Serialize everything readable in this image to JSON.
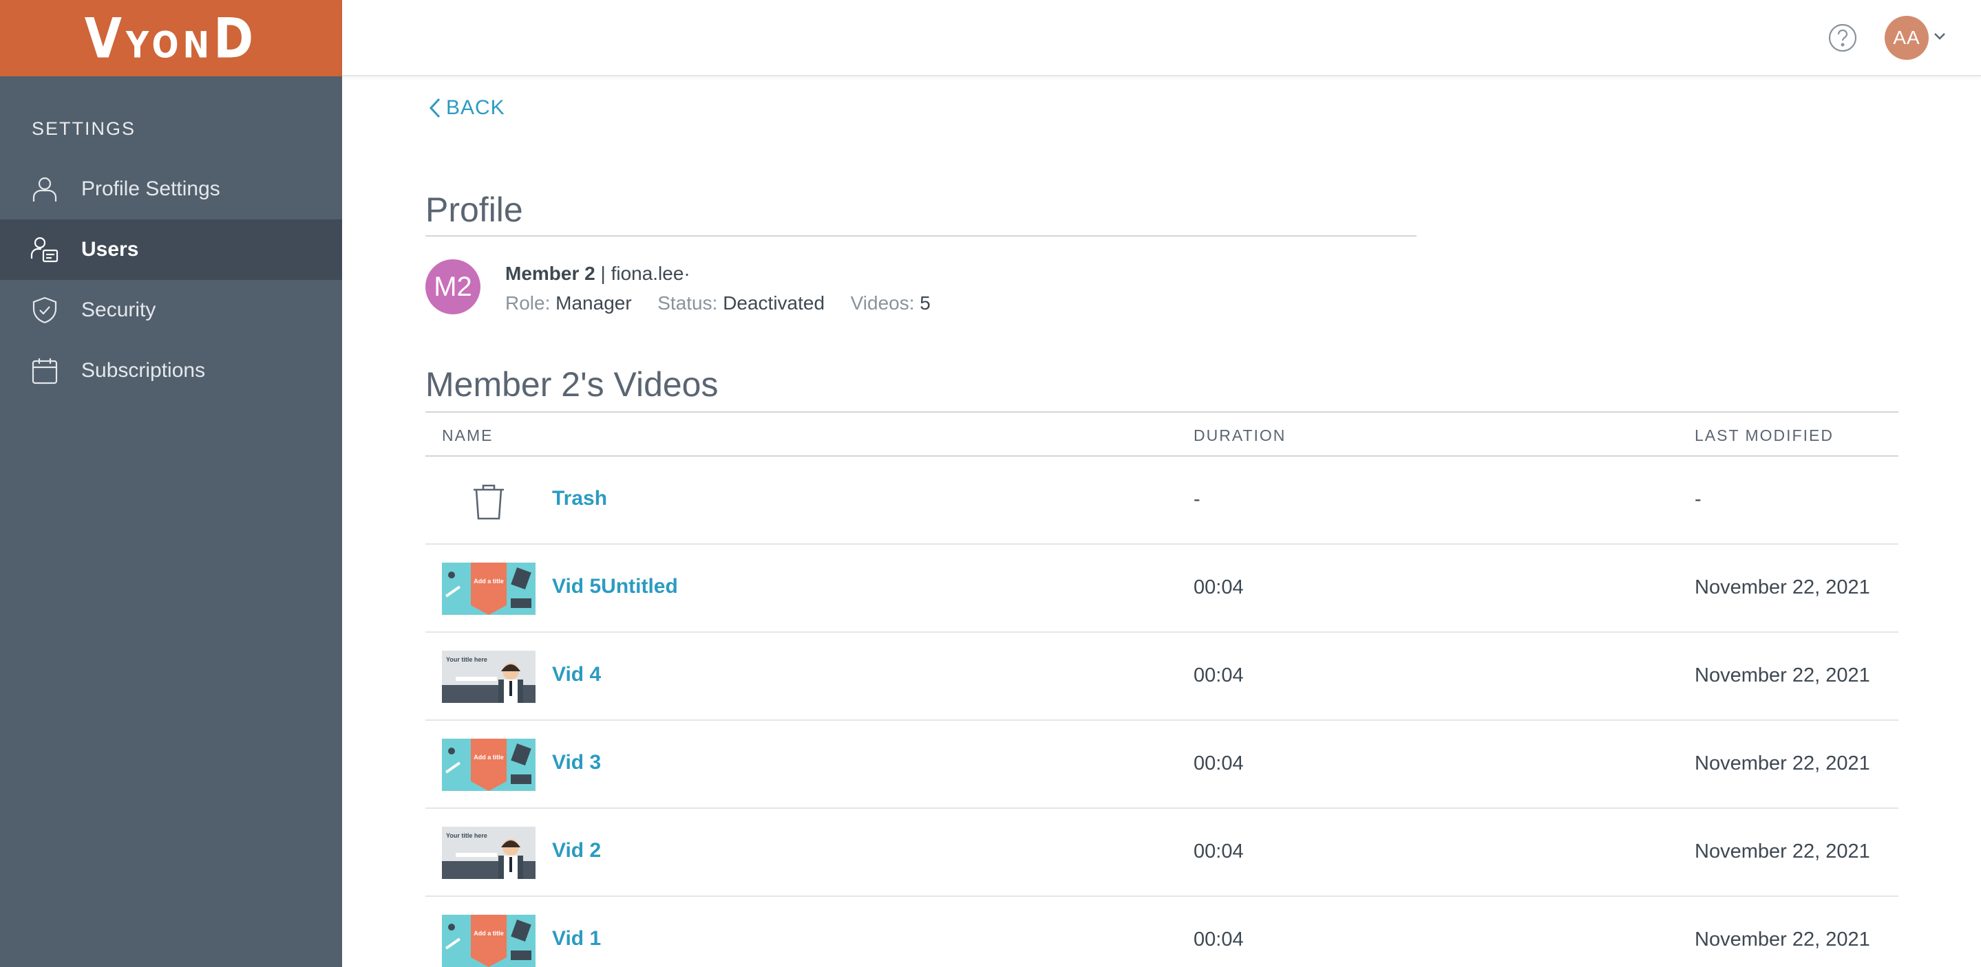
{
  "brand": {
    "logo_text": "VyonD",
    "color": "#cf6538"
  },
  "sidebar": {
    "heading": "SETTINGS",
    "items": [
      {
        "label": "Profile Settings",
        "icon": "person-icon",
        "active": false
      },
      {
        "label": "Users",
        "icon": "users-icon",
        "active": true
      },
      {
        "label": "Security",
        "icon": "shield-icon",
        "active": false
      },
      {
        "label": "Subscriptions",
        "icon": "calendar-icon",
        "active": false
      }
    ]
  },
  "topbar": {
    "help_icon": "help-icon",
    "avatar_initials": "AA"
  },
  "back": {
    "label": "BACK"
  },
  "profile": {
    "title": "Profile",
    "avatar_initials": "M2",
    "avatar_color": "#c86fb9",
    "name": "Member 2",
    "separator": "|",
    "email": "fiona.lee·",
    "role_label": "Role:",
    "role": "Manager",
    "status_label": "Status:",
    "status": "Deactivated",
    "videos_label": "Videos:",
    "videos": "5"
  },
  "videos": {
    "title": "Member 2's Videos",
    "columns": {
      "name": "NAME",
      "duration": "DURATION",
      "modified": "LAST MODIFIED"
    },
    "rows": [
      {
        "name": "Trash",
        "duration": "-",
        "modified": "-",
        "thumb": "trash"
      },
      {
        "name": "Vid 5Untitled",
        "duration": "00:04",
        "modified": "November 22, 2021",
        "thumb": "title"
      },
      {
        "name": "Vid 4",
        "duration": "00:04",
        "modified": "November 22, 2021",
        "thumb": "office"
      },
      {
        "name": "Vid 3",
        "duration": "00:04",
        "modified": "November 22, 2021",
        "thumb": "title"
      },
      {
        "name": "Vid 2",
        "duration": "00:04",
        "modified": "November 22, 2021",
        "thumb": "office"
      },
      {
        "name": "Vid 1",
        "duration": "00:04",
        "modified": "November 22, 2021",
        "thumb": "title"
      }
    ],
    "thumb_text": {
      "title": "Add a title",
      "office": "Your title here"
    }
  }
}
